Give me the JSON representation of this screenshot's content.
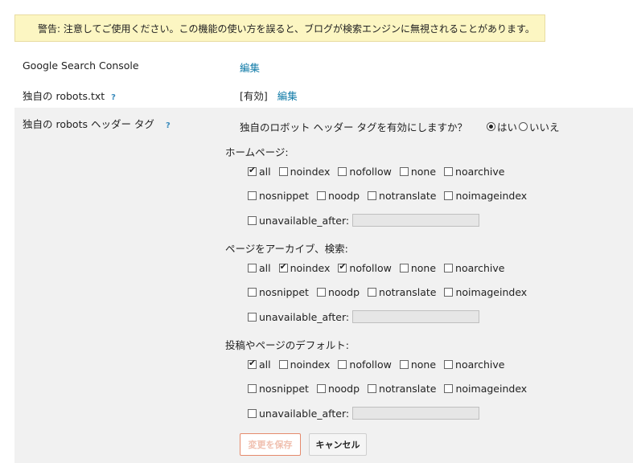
{
  "warning": "警告: 注意してご使用ください。この機能の使い方を誤ると、ブログが検索エンジンに無視されることがあります。",
  "search_console": {
    "label": "Google Search Console",
    "edit": "編集"
  },
  "robots_txt": {
    "label": "独自の robots.txt",
    "help": "?",
    "status": "[有効]",
    "edit": "編集"
  },
  "robots_header": {
    "label": "独自の robots ヘッダー タグ",
    "help": "?",
    "question": "独自のロボット ヘッダー タグを有効にしますか？",
    "yes": "はい",
    "no": "いいえ",
    "selected": "yes",
    "sections": [
      {
        "title": "ホームページ:",
        "row1": [
          {
            "label": "all",
            "checked": true
          },
          {
            "label": "noindex",
            "checked": false
          },
          {
            "label": "nofollow",
            "checked": false
          },
          {
            "label": "none",
            "checked": false
          },
          {
            "label": "noarchive",
            "checked": false
          }
        ],
        "row2": [
          {
            "label": "nosnippet",
            "checked": false
          },
          {
            "label": "noodp",
            "checked": false
          },
          {
            "label": "notranslate",
            "checked": false
          },
          {
            "label": "noimageindex",
            "checked": false
          }
        ],
        "unavailable": {
          "label": "unavailable_after:",
          "checked": false,
          "value": ""
        }
      },
      {
        "title": "ページをアーカイブ、検索:",
        "row1": [
          {
            "label": "all",
            "checked": false
          },
          {
            "label": "noindex",
            "checked": true
          },
          {
            "label": "nofollow",
            "checked": true
          },
          {
            "label": "none",
            "checked": false
          },
          {
            "label": "noarchive",
            "checked": false
          }
        ],
        "row2": [
          {
            "label": "nosnippet",
            "checked": false
          },
          {
            "label": "noodp",
            "checked": false
          },
          {
            "label": "notranslate",
            "checked": false
          },
          {
            "label": "noimageindex",
            "checked": false
          }
        ],
        "unavailable": {
          "label": "unavailable_after:",
          "checked": false,
          "value": ""
        }
      },
      {
        "title": "投稿やページのデフォルト:",
        "row1": [
          {
            "label": "all",
            "checked": true
          },
          {
            "label": "noindex",
            "checked": false
          },
          {
            "label": "nofollow",
            "checked": false
          },
          {
            "label": "none",
            "checked": false
          },
          {
            "label": "noarchive",
            "checked": false
          }
        ],
        "row2": [
          {
            "label": "nosnippet",
            "checked": false
          },
          {
            "label": "noodp",
            "checked": false
          },
          {
            "label": "notranslate",
            "checked": false
          },
          {
            "label": "noimageindex",
            "checked": false
          }
        ],
        "unavailable": {
          "label": "unavailable_after:",
          "checked": false,
          "value": ""
        }
      }
    ]
  },
  "buttons": {
    "save": "変更を保存",
    "cancel": "キャンセル"
  },
  "colors": {
    "link": "#0f7aa7",
    "warning_bg": "#fcf6c2",
    "panel_bg": "#f1f1f1",
    "save_border": "#e58a6c"
  }
}
